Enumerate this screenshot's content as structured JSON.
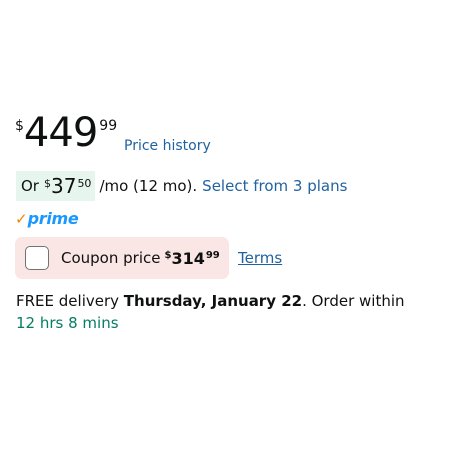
{
  "price": {
    "symbol": "$",
    "whole": "449",
    "fraction": "99",
    "history_link": "Price history"
  },
  "installment": {
    "or_label": "Or",
    "symbol": "$",
    "whole": "37",
    "fraction": "50",
    "term": "/mo (12 mo).",
    "plans_link": "Select from 3 plans"
  },
  "prime": {
    "check": "✓",
    "label": "prime"
  },
  "coupon": {
    "label": "Coupon price",
    "symbol": "$",
    "whole": "314",
    "fraction": "99",
    "terms_link": "Terms",
    "checked": false
  },
  "delivery": {
    "prefix": "FREE delivery ",
    "date": "Thursday, January 22",
    "middle": ". Order within ",
    "countdown": "12 hrs 8 mins"
  },
  "colors": {
    "link": "#2162a1",
    "installment_bg": "#e7f5ef",
    "coupon_bg": "#fbe6e6",
    "prime_blue": "#1a98ff",
    "prime_check": "#f08804",
    "countdown_green": "#067d62"
  }
}
